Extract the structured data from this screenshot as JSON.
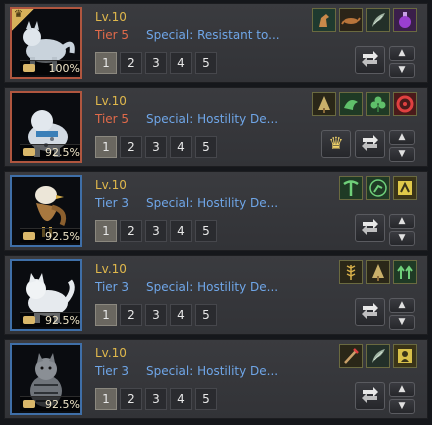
{
  "pets": [
    {
      "level": "Lv.10",
      "tier": "Tier 5",
      "tier_num": 5,
      "special": "Special: Resistant to...",
      "percent": "100%",
      "has_crown_badge": true,
      "show_crown_button": false,
      "creature": "wolf",
      "pages": [
        "1",
        "2",
        "3",
        "4",
        "5"
      ],
      "active_page": 0,
      "skills": [
        {
          "icon": "horse-icon",
          "bg": "#1f3a2f"
        },
        {
          "icon": "lizard-icon",
          "bg": "#2b2418"
        },
        {
          "icon": "wing-icon",
          "bg": "#233029"
        },
        {
          "icon": "potion-icon",
          "bg": "#3a1f4a"
        }
      ]
    },
    {
      "level": "Lv.10",
      "tier": "Tier 5",
      "tier_num": 5,
      "special": "Special: Hostility De...",
      "percent": "92.5%",
      "has_crown_badge": false,
      "show_crown_button": true,
      "creature": "snow-leopard",
      "pages": [
        "1",
        "2",
        "3",
        "4",
        "5"
      ],
      "active_page": 0,
      "skills": [
        {
          "icon": "tree-icon",
          "bg": "#2a2718"
        },
        {
          "icon": "wolf-head-icon",
          "bg": "#1f3a25"
        },
        {
          "icon": "clover-icon",
          "bg": "#1f3a25"
        },
        {
          "icon": "rage-icon",
          "bg": "#4a1a1a"
        }
      ]
    },
    {
      "level": "Lv.10",
      "tier": "Tier 3",
      "tier_num": 3,
      "special": "Special: Hostility De...",
      "percent": "92.5%",
      "has_crown_badge": false,
      "show_crown_button": false,
      "creature": "eagle",
      "pages": [
        "1",
        "2",
        "3",
        "4",
        "5"
      ],
      "active_page": 0,
      "skills": [
        {
          "icon": "pickaxe-icon",
          "bg": "#1f3a25"
        },
        {
          "icon": "sprint-icon",
          "bg": "#1f3a25"
        },
        {
          "icon": "gather-icon",
          "bg": "#3a3418"
        }
      ]
    },
    {
      "level": "Lv.10",
      "tier": "Tier 3",
      "tier_num": 3,
      "special": "Special: Hostility De...",
      "percent": "92.5%",
      "has_crown_badge": false,
      "show_crown_button": false,
      "creature": "white-cat",
      "pages": [
        "1",
        "2",
        "3",
        "4",
        "5"
      ],
      "active_page": 0,
      "skills": [
        {
          "icon": "wheat-icon",
          "bg": "#2a2718"
        },
        {
          "icon": "tree-icon",
          "bg": "#2a2718"
        },
        {
          "icon": "growth-icon",
          "bg": "#1f3a25"
        }
      ]
    },
    {
      "level": "Lv.10",
      "tier": "Tier 3",
      "tier_num": 3,
      "special": "Special: Hostility De...",
      "percent": "92.5%",
      "has_crown_badge": false,
      "show_crown_button": false,
      "creature": "tabby-cat",
      "pages": [
        "1",
        "2",
        "3",
        "4",
        "5"
      ],
      "active_page": 0,
      "skills": [
        {
          "icon": "hoe-icon",
          "bg": "#2a2718"
        },
        {
          "icon": "wing-icon",
          "bg": "#233029"
        },
        {
          "icon": "loot-icon",
          "bg": "#3a3418"
        }
      ]
    }
  ],
  "buttons": {
    "up": "▲",
    "down": "▼",
    "crown": "♛"
  }
}
